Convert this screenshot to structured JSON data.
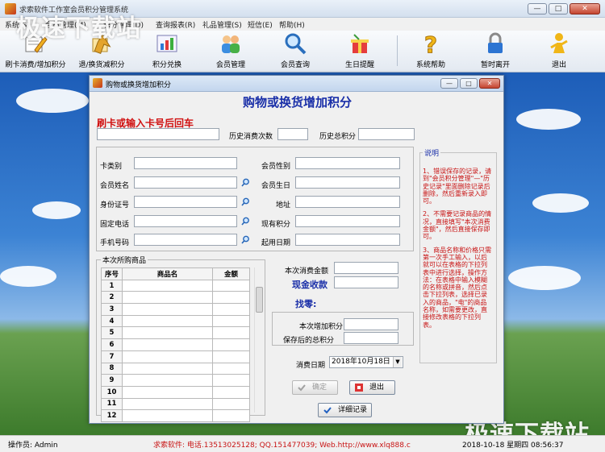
{
  "window": {
    "title": "求索软件工作室会员积分管理系统",
    "controls": [
      "—",
      "□",
      "✕"
    ]
  },
  "menu": [
    "系统(S)",
    "会员管理(M)",
    "积分管理(D)",
    "查询报表(R)",
    "礼品管理(S)",
    "短信(E)",
    "帮助(H)"
  ],
  "toolbar": [
    {
      "label": "刷卡消费/增加积分",
      "icon": "pencil-paper-icon"
    },
    {
      "label": "退/换货减积分",
      "icon": "return-goods-icon"
    },
    {
      "label": "积分兑换",
      "icon": "exchange-chart-icon"
    },
    {
      "label": "会员管理",
      "icon": "members-icon"
    },
    {
      "label": "会员查询",
      "icon": "magnifier-icon"
    },
    {
      "label": "生日提醒",
      "icon": "birthday-gift-icon"
    },
    {
      "label": "系统帮助",
      "icon": "question-mark-icon"
    },
    {
      "label": "暂时离开",
      "icon": "lock-icon"
    },
    {
      "label": "退出",
      "icon": "exit-person-icon"
    }
  ],
  "watermark": "极速下载站",
  "dialog": {
    "title": "购物或换货增加积分",
    "heading": "购物或换货增加积分",
    "swipe_label": "刷卡或输入卡号后回车",
    "history_count_label": "历史消费次数",
    "history_points_label": "历史总积分",
    "fields_left": [
      "卡类别",
      "会员姓名",
      "身份证号",
      "固定电话",
      "手机号码"
    ],
    "fields_right": [
      "会员性别",
      "会员生日",
      "地址",
      "现有积分",
      "起用日期"
    ],
    "goods_section": "本次所购商品",
    "goods_columns": [
      "序号",
      "商品名",
      "金额"
    ],
    "goods_rows": [
      "1",
      "2",
      "3",
      "4",
      "5",
      "6",
      "7",
      "8",
      "9",
      "10",
      "11",
      "12"
    ],
    "amount_label": "本次消费金额",
    "cash_label": "现金收款",
    "change_label": "找零:",
    "add_points_label": "本次增加积分",
    "total_after_label": "保存后的总积分",
    "date_label": "消费日期",
    "date_value": "2018年10月18日",
    "confirm_button": "确定",
    "exit_button": "退出",
    "detail_button": "详细记录",
    "note_title": "说明",
    "notes": [
      "1、错误保存的记录，请到\"会员积分管理\"—\"历史记录\"里面删除记录后删除，然后重新录入即可。",
      "2、不需要记录商品的情况，直接填写\"本次消费金额\"，然后直接保存即可。",
      "3、商品名称和价格只需第一次手工输入，以后就可以在表格的下拉列表中进行选择，操作方法：在表格中输入模糊的名称或拼音，然后点击下拉列表，选择已录入的商品，\"电\"的商品名称，如需要更改，直接修改表格的下拉列表。"
    ]
  },
  "status": {
    "operator": "操作员: Admin",
    "contact": "求索软件: 电话.13513025128; QQ.151477039; Web.http://www.xlq888.c",
    "datetime": "2018-10-18 星期四 08:56:37"
  },
  "colors": {
    "heading_blue": "#1a2fa8",
    "alert_red": "#d01010"
  }
}
